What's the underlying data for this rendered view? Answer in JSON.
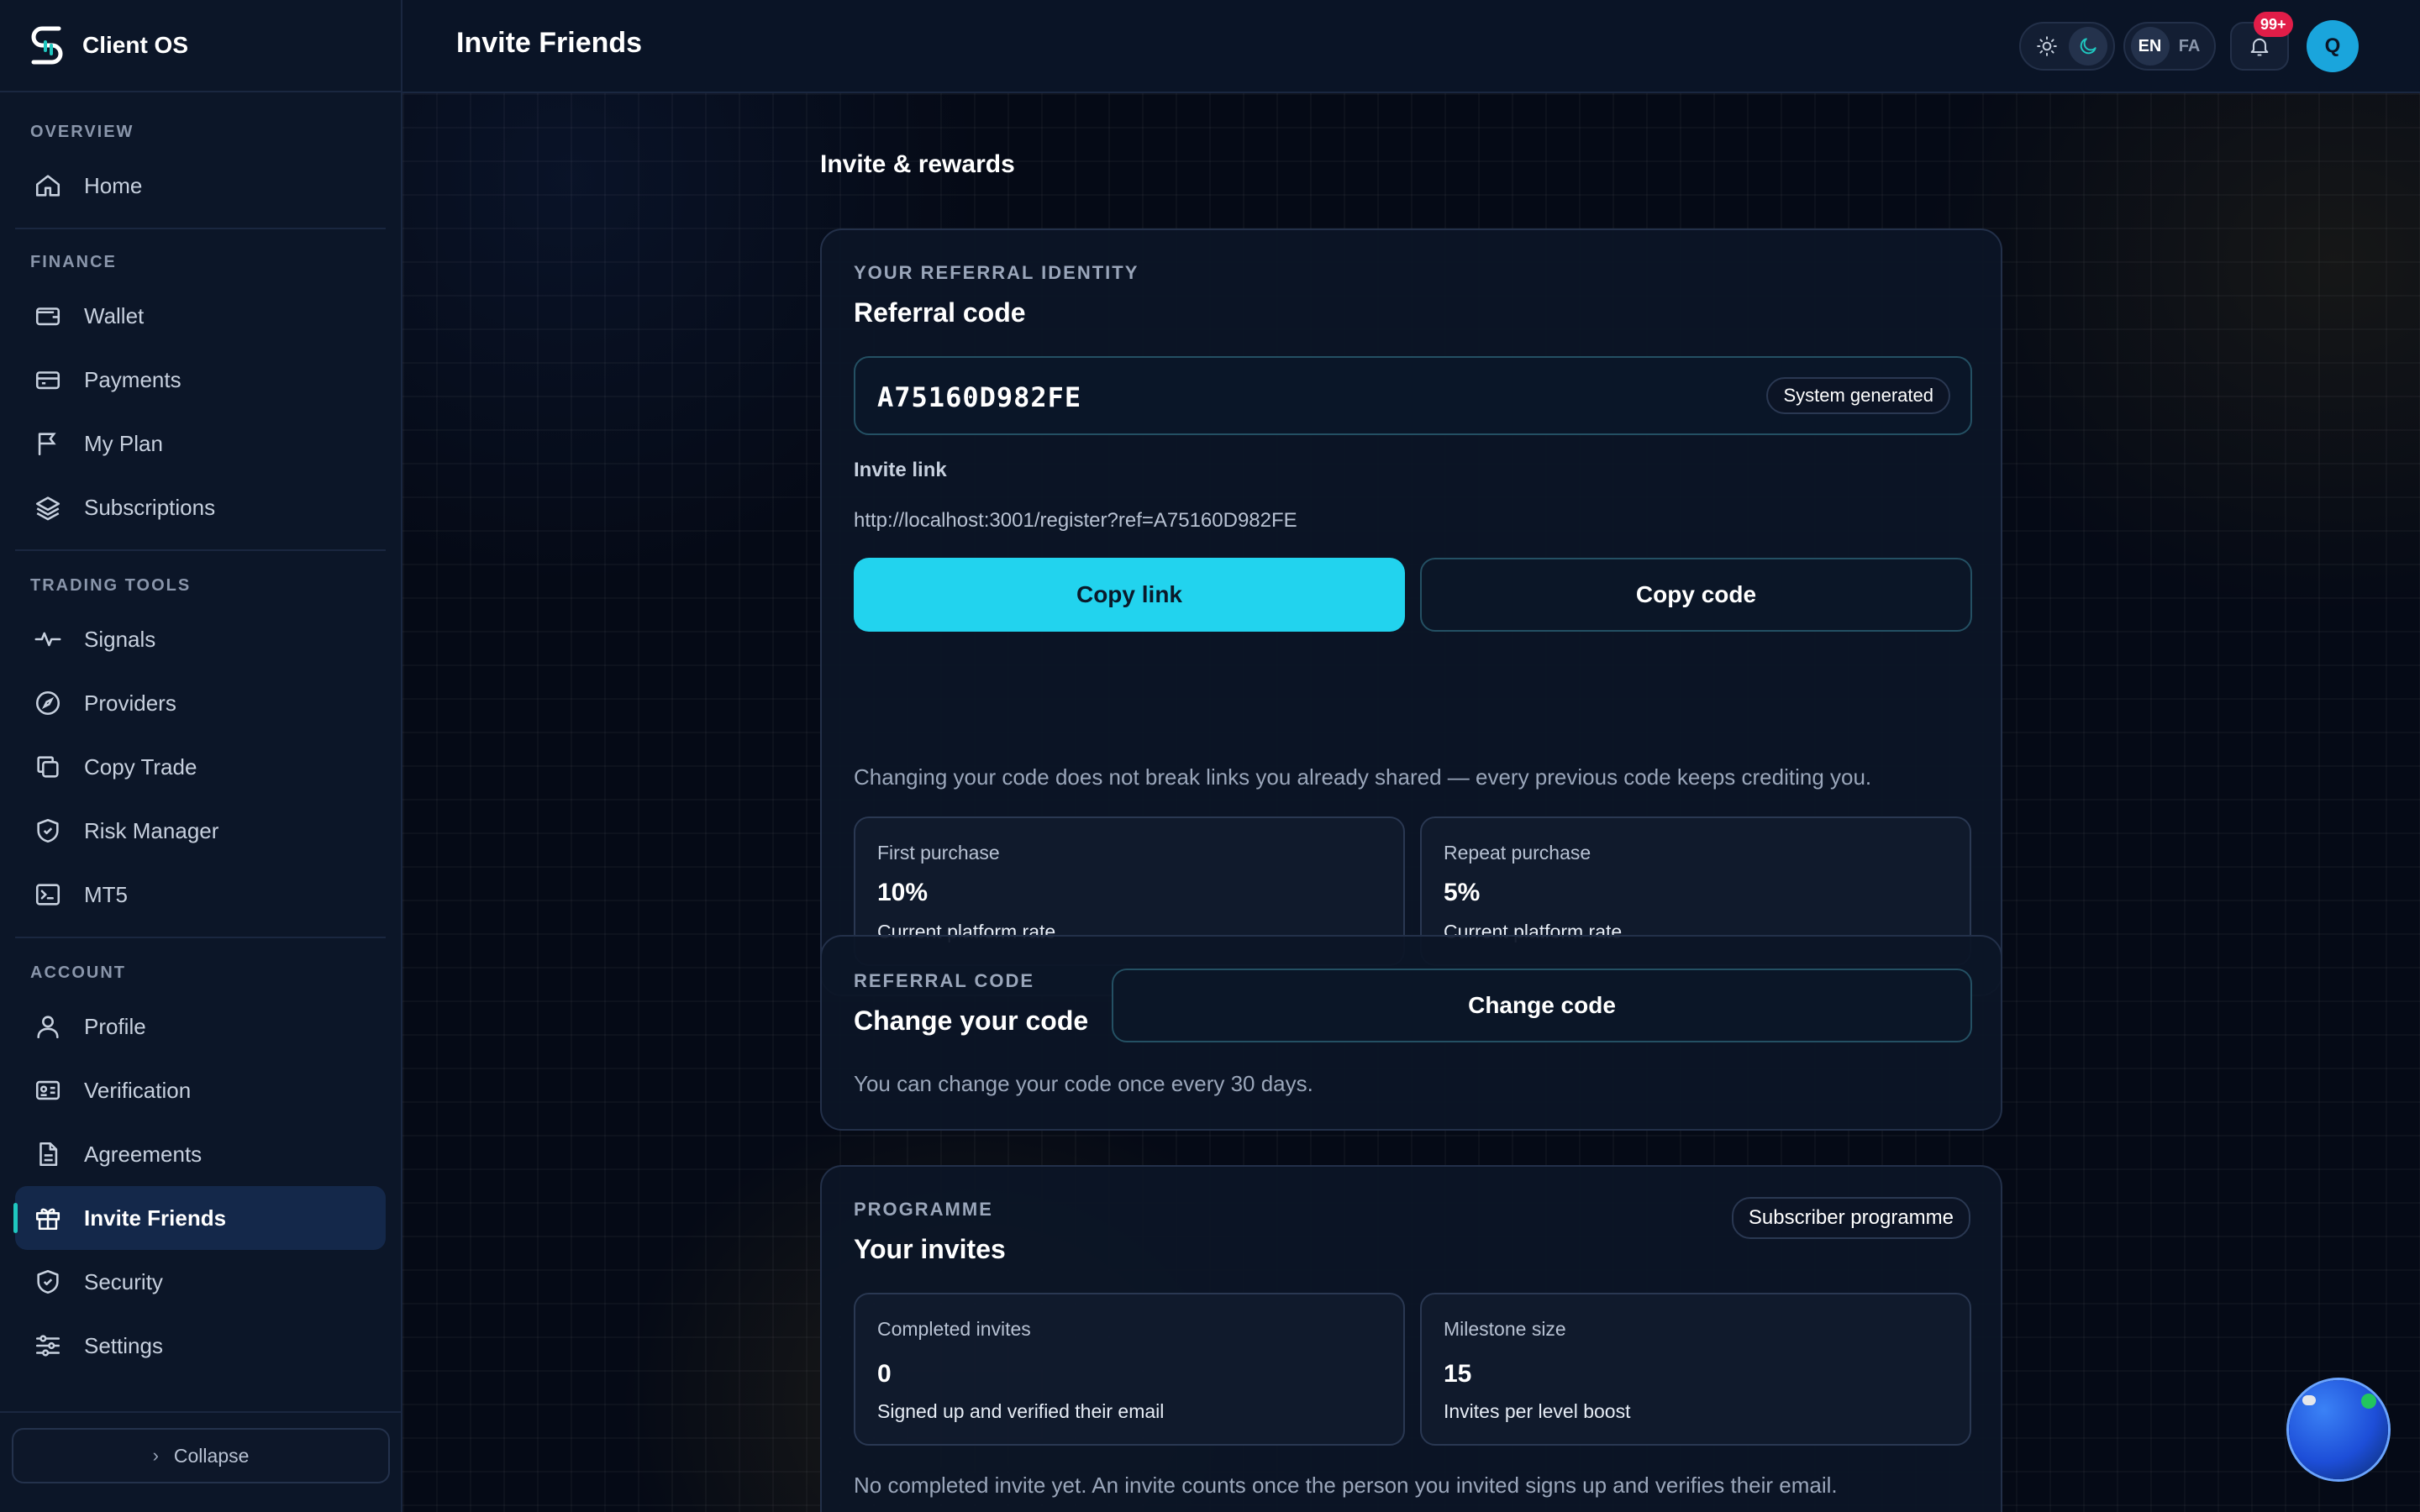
{
  "brand": {
    "name": "Client OS"
  },
  "header": {
    "title": "Invite Friends",
    "lang_en": "EN",
    "lang_fa": "FA",
    "notif_badge": "99+",
    "avatar_initial": "Q"
  },
  "sidebar": {
    "sections": [
      {
        "heading": "OVERVIEW",
        "items": [
          {
            "label": "Home",
            "icon": "home-icon"
          }
        ]
      },
      {
        "heading": "FINANCE",
        "items": [
          {
            "label": "Wallet",
            "icon": "wallet-icon"
          },
          {
            "label": "Payments",
            "icon": "credit-card-icon"
          },
          {
            "label": "My Plan",
            "icon": "flag-icon"
          },
          {
            "label": "Subscriptions",
            "icon": "layers-icon"
          }
        ]
      },
      {
        "heading": "TRADING TOOLS",
        "items": [
          {
            "label": "Signals",
            "icon": "activity-icon"
          },
          {
            "label": "Providers",
            "icon": "compass-icon"
          },
          {
            "label": "Copy Trade",
            "icon": "copy-icon"
          },
          {
            "label": "Risk Manager",
            "icon": "shield-check-icon"
          },
          {
            "label": "MT5",
            "icon": "terminal-icon"
          }
        ]
      },
      {
        "heading": "ACCOUNT",
        "items": [
          {
            "label": "Profile",
            "icon": "user-icon"
          },
          {
            "label": "Verification",
            "icon": "id-card-icon"
          },
          {
            "label": "Agreements",
            "icon": "document-icon"
          },
          {
            "label": "Invite Friends",
            "icon": "gift-icon",
            "active": true
          },
          {
            "label": "Security",
            "icon": "shield-check-icon"
          },
          {
            "label": "Settings",
            "icon": "sliders-icon"
          }
        ]
      }
    ],
    "collapse_label": "Collapse"
  },
  "main": {
    "section_title": "Invite & rewards",
    "identity": {
      "eyebrow": "YOUR REFERRAL IDENTITY",
      "title": "Referral code",
      "code": "A75160D982FE",
      "code_badge": "System generated",
      "invite_link_label": "Invite link",
      "invite_link": "http://localhost:3001/register?ref=A75160D982FE",
      "copy_link": "Copy link",
      "copy_code": "Copy code",
      "note": "Changing your code does not break links you already shared — every previous code keeps crediting you.",
      "stats": [
        {
          "label": "First purchase",
          "value": "10%",
          "sub": "Current platform rate"
        },
        {
          "label": "Repeat purchase",
          "value": "5%",
          "sub": "Current platform rate"
        }
      ]
    },
    "change": {
      "eyebrow": "REFERRAL CODE",
      "title": "Change your code",
      "button": "Change code",
      "note": "You can change your code once every 30 days."
    },
    "programme": {
      "eyebrow": "PROGRAMME",
      "title": "Your invites",
      "badge": "Subscriber programme",
      "stats": [
        {
          "label": "Completed invites",
          "value": "0",
          "sub": "Signed up and verified their email"
        },
        {
          "label": "Milestone size",
          "value": "15",
          "sub": "Invites per level boost"
        }
      ],
      "note": "No completed invite yet. An invite counts once the person you invited signs up and verifies their email."
    }
  },
  "colors": {
    "accent": "#22d3ee",
    "active_indicator": "#1fc7c0",
    "badge": "#e11d48"
  }
}
